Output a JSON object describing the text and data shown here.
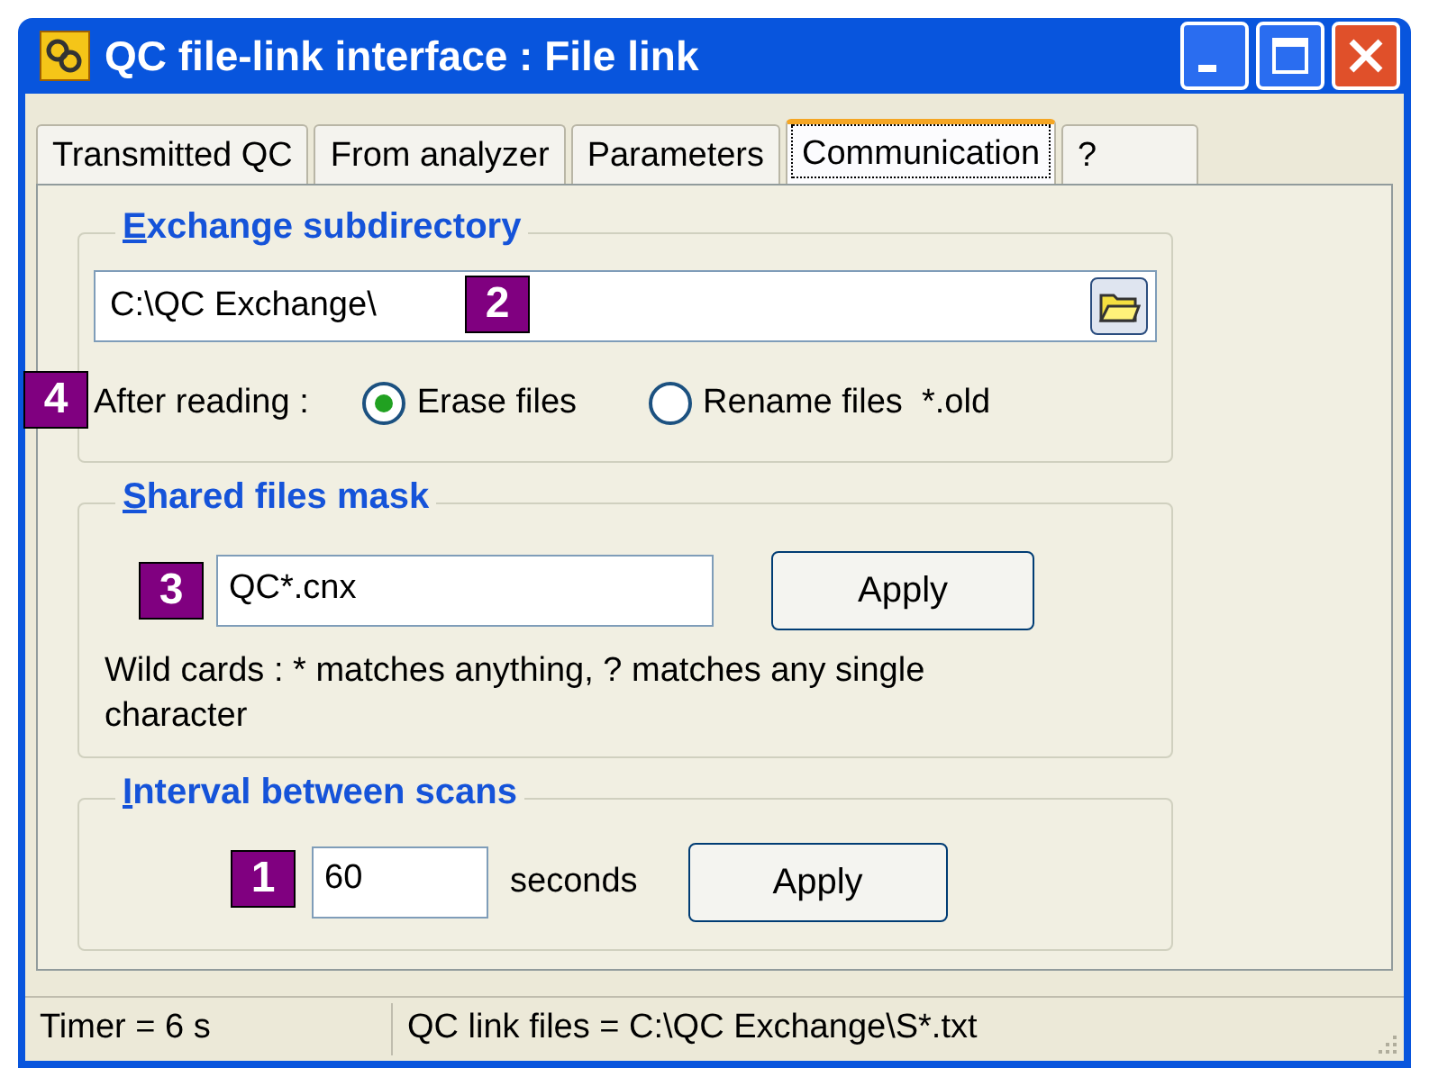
{
  "window": {
    "title": "QC file-link interface : File link"
  },
  "tabs": [
    {
      "label": "Transmitted QC",
      "selected": false
    },
    {
      "label": "From analyzer",
      "selected": false
    },
    {
      "label": "Parameters",
      "selected": false
    },
    {
      "label": "Communication",
      "selected": true
    },
    {
      "label": "?",
      "selected": false
    }
  ],
  "exchange": {
    "title": "Exchange subdirectory",
    "path": "C:\\QC Exchange\\",
    "badge": "2",
    "after_reading_badge": "4",
    "after_reading_label": "After reading :",
    "options": [
      {
        "label": "Erase files",
        "selected": true
      },
      {
        "label": "Rename files  *.old",
        "selected": false
      }
    ]
  },
  "mask": {
    "title": "Shared files mask",
    "value": "QC*.cnx",
    "badge": "3",
    "button": "Apply",
    "note": "Wild cards : * matches anything, ? matches any single character"
  },
  "interval": {
    "title": "Interval between scans",
    "value": "60",
    "badge": "1",
    "unit": "seconds",
    "button": "Apply"
  },
  "status_bar": [
    "Timer = 6 s",
    "QC link files = C:\\QC Exchange\\S*.txt"
  ]
}
